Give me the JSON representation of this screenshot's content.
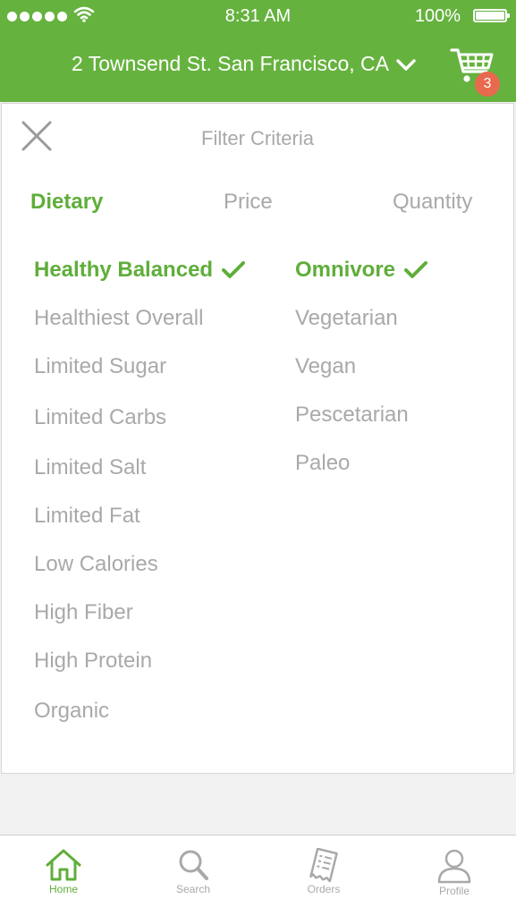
{
  "status_bar": {
    "time": "8:31 AM",
    "battery_percent": "100%",
    "signal_icon": "signal-dots-icon",
    "wifi_icon": "wifi-icon",
    "battery_icon": "battery-icon"
  },
  "header": {
    "address": "2 Townsend St. San Francisco, CA",
    "address_chevron_icon": "chevron-down-icon",
    "cart_icon": "shopping-cart-icon",
    "cart_count": "3",
    "bg_color": "#66b23f"
  },
  "filter": {
    "close_icon": "close-icon",
    "title": "Filter Criteria",
    "tabs": [
      {
        "label": "Dietary",
        "active": true
      },
      {
        "label": "Price",
        "active": false
      },
      {
        "label": "Quantity",
        "active": false
      }
    ],
    "left_options": [
      {
        "label": "Healthy Balanced",
        "selected": true
      },
      {
        "label": "Healthiest Overall",
        "selected": false
      },
      {
        "label": "Limited Sugar",
        "selected": false
      },
      {
        "label": "Limited Carbs",
        "selected": false
      },
      {
        "label": "Limited Salt",
        "selected": false
      },
      {
        "label": "Limited Fat",
        "selected": false
      },
      {
        "label": "Low Calories",
        "selected": false
      },
      {
        "label": "High Fiber",
        "selected": false
      },
      {
        "label": "High Protein",
        "selected": false
      },
      {
        "label": "Organic",
        "selected": false
      }
    ],
    "right_options": [
      {
        "label": "Omnivore",
        "selected": true
      },
      {
        "label": "Vegetarian",
        "selected": false
      },
      {
        "label": "Vegan",
        "selected": false
      },
      {
        "label": "Pescetarian",
        "selected": false
      },
      {
        "label": "Paleo",
        "selected": false
      }
    ],
    "selected_color": "#5fae3a",
    "unselected_color": "#a9a9a9"
  },
  "bottom_nav": [
    {
      "label": "Home",
      "icon": "home-icon",
      "active": true
    },
    {
      "label": "Search",
      "icon": "search-icon",
      "active": false
    },
    {
      "label": "Orders",
      "icon": "receipt-icon",
      "active": false
    },
    {
      "label": "Profile",
      "icon": "profile-icon",
      "active": false
    }
  ]
}
